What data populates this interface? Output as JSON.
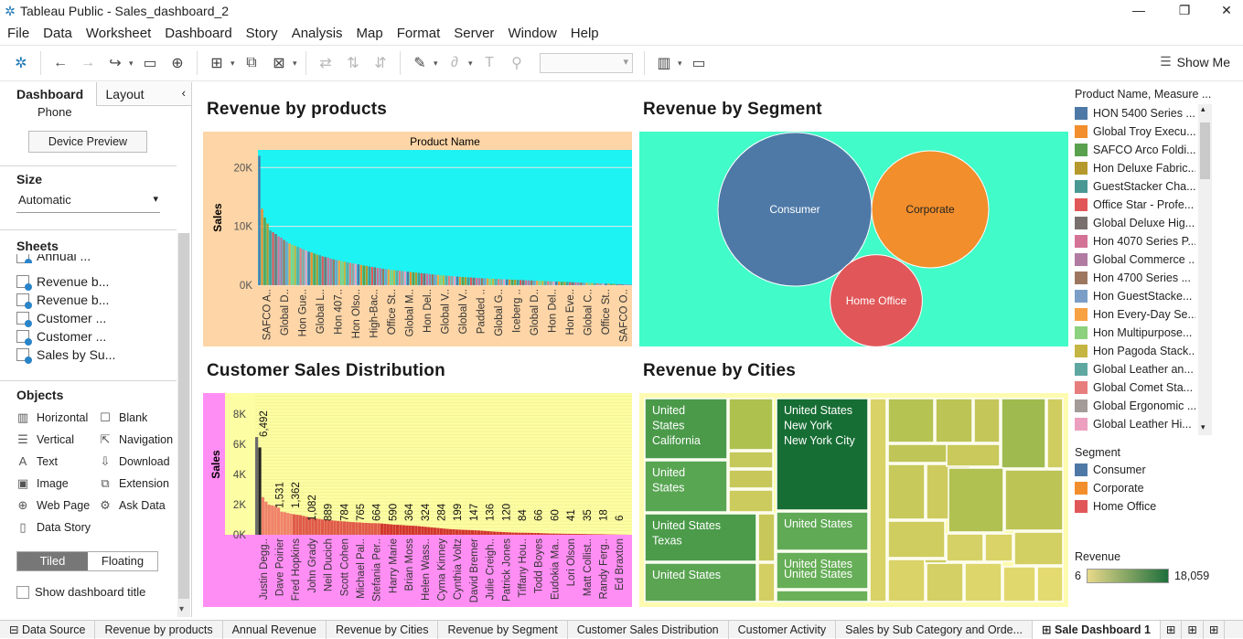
{
  "window": {
    "title": "Tableau Public - Sales_dashboard_2"
  },
  "menu": [
    "File",
    "Data",
    "Worksheet",
    "Dashboard",
    "Story",
    "Analysis",
    "Map",
    "Format",
    "Server",
    "Window",
    "Help"
  ],
  "toolbar": {
    "show_me": "Show Me"
  },
  "left_pane": {
    "tab_dashboard": "Dashboard",
    "tab_layout": "Layout",
    "device": "Phone",
    "device_preview": "Device Preview",
    "size_header": "Size",
    "size_value": "Automatic",
    "sheets_header": "Sheets",
    "sheets": [
      "Annual ...",
      "Revenue b...",
      "Revenue b...",
      "Customer ...",
      "Customer ...",
      "Sales by Su..."
    ],
    "objects_header": "Objects",
    "objects": [
      {
        "label": "Horizontal",
        "icon": "horizontal-icon"
      },
      {
        "label": "Blank",
        "icon": "blank-icon"
      },
      {
        "label": "Vertical",
        "icon": "vertical-icon"
      },
      {
        "label": "Navigation",
        "icon": "navigation-icon"
      },
      {
        "label": "Text",
        "icon": "text-icon"
      },
      {
        "label": "Download",
        "icon": "download-icon"
      },
      {
        "label": "Image",
        "icon": "image-icon"
      },
      {
        "label": "Extension",
        "icon": "extension-icon"
      },
      {
        "label": "Web Page",
        "icon": "web-page-icon"
      },
      {
        "label": "Ask Data",
        "icon": "ask-data-icon"
      },
      {
        "label": "Data Story",
        "icon": "data-story-icon"
      }
    ],
    "tiled": "Tiled",
    "floating": "Floating",
    "show_title": "Show dashboard title"
  },
  "dashboard": {
    "t1": "Revenue by products",
    "t2": "Revenue  by Segment",
    "t3": "Customer  Sales Distribution",
    "t4": "Revenue  by Cities"
  },
  "chart_data": [
    {
      "type": "bar",
      "title": "Revenue by products",
      "header": "Product Name",
      "ylabel": "Sales",
      "yticks": [
        "0K",
        "10K",
        "20K"
      ],
      "ylim": [
        0,
        23000
      ],
      "tick_labels": [
        "SAFCO A..",
        "Global D..",
        "Hon Gue..",
        "Global L..",
        "Hon 407..",
        "Hon Olso..",
        "High-Bac..",
        "Office St..",
        "Global M..",
        "Hon Del..",
        "Global V..",
        "Global V..",
        "Padded ..",
        "Global G..",
        "Iceberg ..",
        "Global D..",
        "Hon Del..",
        "Hon Eve..",
        "Global C..",
        "Office St..",
        "SAFCO O.."
      ],
      "values": [
        22000,
        13000,
        11500,
        10500,
        9300,
        9000,
        8700,
        8300,
        8100,
        7700,
        7400,
        7100,
        6900,
        6700,
        6500,
        6300,
        6100,
        5900,
        5700,
        5600,
        5400,
        5200,
        5100,
        4900,
        4800,
        4700,
        4500,
        4400,
        4300,
        4200,
        4100,
        4000,
        3900,
        3800,
        3700,
        3650,
        3550,
        3450,
        3350,
        3300,
        3200,
        3100,
        3050,
        2950,
        2900,
        2800,
        2750,
        2700,
        2600,
        2550,
        2500,
        2450,
        2400,
        2350,
        2300,
        2250,
        2200,
        2150,
        2100,
        2050,
        2000,
        1950,
        1900,
        1850,
        1800,
        1750,
        1700,
        1650,
        1620,
        1580,
        1550,
        1500,
        1470,
        1430,
        1400,
        1370,
        1340,
        1310,
        1280,
        1250,
        1220,
        1200,
        1170,
        1150,
        1120,
        1100,
        1080,
        1050,
        1030,
        1010,
        990,
        970,
        950,
        930,
        910,
        890,
        870,
        850,
        830,
        810,
        790,
        770,
        750,
        730,
        710,
        690,
        670,
        650,
        630,
        610,
        590,
        570,
        550,
        530,
        510,
        490,
        470,
        450,
        430,
        410,
        390,
        370,
        350,
        330,
        310,
        290,
        270,
        250,
        230,
        210,
        190,
        170,
        150,
        130,
        110,
        90
      ]
    },
    {
      "type": "bubble",
      "title": "Revenue  by Segment",
      "series": [
        {
          "name": "Consumer",
          "value": 1.0,
          "color": "#4e79a7"
        },
        {
          "name": "Corporate",
          "value": 0.58,
          "color": "#f28e2b"
        },
        {
          "name": "Home Office",
          "value": 0.36,
          "color": "#e15759"
        }
      ]
    },
    {
      "type": "bar",
      "title": "Customer  Sales Distribution",
      "ylabel": "Sales",
      "yticks": [
        "0K",
        "2K",
        "4K",
        "6K",
        "8K"
      ],
      "ylim": [
        0,
        8800
      ],
      "tick_labels": [
        "Justin Degg..",
        "Dave Poirier",
        "Fred Hopkins",
        "John Grady",
        "Neil Ducich",
        "Scott Cohen",
        "Michael Pal..",
        "Stefania Per..",
        "Harry Marie",
        "Brian Moss",
        "Helen Wass..",
        "Cyma Kinney",
        "Cynthia Voltz",
        "David Bremer",
        "Julie Creigh..",
        "Patrick Jones",
        "Tiffany Hou..",
        "Todd Boyes",
        "Eudokia Ma..",
        "Lori Olson",
        "Matt Collist..",
        "Randy Ferg..",
        "Ed Braxton"
      ],
      "labels": [
        "6,492",
        "1,531",
        "1,362",
        "1,082",
        "889",
        "784",
        "765",
        "664",
        "590",
        "364",
        "324",
        "284",
        "199",
        "147",
        "136",
        "120",
        "84",
        "66",
        "60",
        "41",
        "35",
        "18",
        "6"
      ],
      "values": [
        6492,
        5800,
        2500,
        2200,
        2000,
        1950,
        1900,
        1800,
        1531,
        1500,
        1450,
        1400,
        1362,
        1330,
        1300,
        1250,
        1200,
        1150,
        1100,
        1082,
        1050,
        1020,
        1000,
        980,
        960,
        940,
        920,
        900,
        889,
        870,
        850,
        840,
        830,
        820,
        800,
        790,
        784,
        775,
        770,
        765,
        750,
        730,
        710,
        690,
        670,
        664,
        650,
        635,
        620,
        610,
        600,
        590,
        570,
        550,
        530,
        510,
        490,
        470,
        450,
        430,
        410,
        390,
        375,
        364,
        350,
        340,
        330,
        324,
        315,
        305,
        295,
        284,
        270,
        255,
        240,
        225,
        210,
        199,
        190,
        180,
        170,
        160,
        150,
        147,
        142,
        138,
        136,
        132,
        128,
        124,
        120,
        110,
        100,
        92,
        86,
        84,
        80,
        76,
        72,
        68,
        66,
        64,
        62,
        60,
        55,
        50,
        45,
        41,
        39,
        37,
        35,
        30,
        25,
        20,
        18,
        14,
        10,
        8,
        6
      ]
    },
    {
      "type": "treemap",
      "title": "Revenue  by Cities",
      "labels": [
        "United States California",
        "United States",
        "United States New York New York City",
        "United States",
        "United States Texas",
        "United States",
        "United States",
        "United States"
      ]
    }
  ],
  "legend": {
    "product_header": "Product Name, Measure ...",
    "products": [
      {
        "name": "HON 5400 Series ...",
        "color": "#4e79a7"
      },
      {
        "name": "Global Troy Execu...",
        "color": "#f28e2b"
      },
      {
        "name": "SAFCO Arco Foldi...",
        "color": "#59a14f"
      },
      {
        "name": "Hon Deluxe Fabric...",
        "color": "#b6992d"
      },
      {
        "name": "GuestStacker Cha...",
        "color": "#499894"
      },
      {
        "name": "Office Star - Profe...",
        "color": "#e15759"
      },
      {
        "name": "Global Deluxe Hig...",
        "color": "#79706e"
      },
      {
        "name": "Hon 4070 Series P...",
        "color": "#d37295"
      },
      {
        "name": "Global Commerce ...",
        "color": "#b07aa1"
      },
      {
        "name": "Hon 4700 Series ...",
        "color": "#9d7660"
      },
      {
        "name": "Hon GuestStacke...",
        "color": "#7a9ec7"
      },
      {
        "name": "Hon Every-Day Se...",
        "color": "#f7a143"
      },
      {
        "name": "Hon Multipurpose...",
        "color": "#8cd17d"
      },
      {
        "name": "Hon Pagoda Stack...",
        "color": "#c5b542"
      },
      {
        "name": "Global Leather an...",
        "color": "#5fa8a2"
      },
      {
        "name": "Global Comet Sta...",
        "color": "#e87d7e"
      },
      {
        "name": "Global Ergonomic ...",
        "color": "#a39b98"
      },
      {
        "name": "Global Leather Hi...",
        "color": "#ec9fbe"
      }
    ],
    "segment_header": "Segment",
    "segments": [
      {
        "name": "Consumer",
        "color": "#4e79a7"
      },
      {
        "name": "Corporate",
        "color": "#f28e2b"
      },
      {
        "name": "Home Office",
        "color": "#e15759"
      }
    ],
    "revenue_header": "Revenue",
    "revenue_min": "6",
    "revenue_max": "18,059"
  },
  "tabs": [
    "Data Source",
    "Revenue by products",
    "Annual Revenue",
    "Revenue  by Cities",
    "Revenue  by Segment",
    "Customer  Sales Distribution",
    "Customer Activity",
    "Sales by Sub Category and Orde...",
    "Sale Dashboard 1"
  ]
}
